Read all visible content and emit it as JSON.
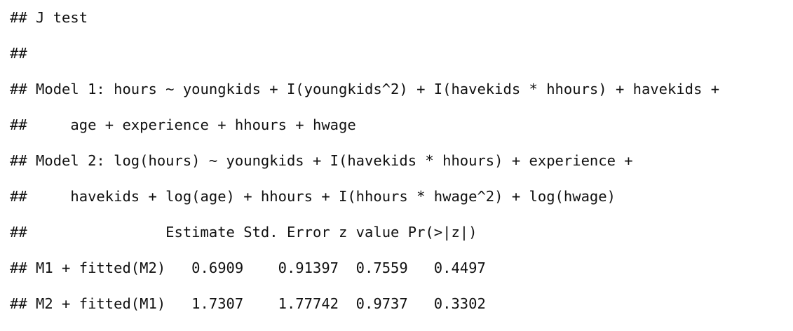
{
  "output": {
    "lines": [
      "## J test",
      "##",
      "## Model 1: hours ~ youngkids + I(youngkids^2) + I(havekids * hhours) + havekids +",
      "##     age + experience + hhours + hwage",
      "## Model 2: log(hours) ~ youngkids + I(havekids * hhours) + experience +",
      "##     havekids + log(age) + hhours + I(hhours * hwage^2) + log(hwage)",
      "##                Estimate Std. Error z value Pr(>|z|)",
      "## M1 + fitted(M2)   0.6909    0.91397  0.7559   0.4497",
      "## M2 + fitted(M1)   1.7307    1.77742  0.9737   0.3302"
    ]
  }
}
